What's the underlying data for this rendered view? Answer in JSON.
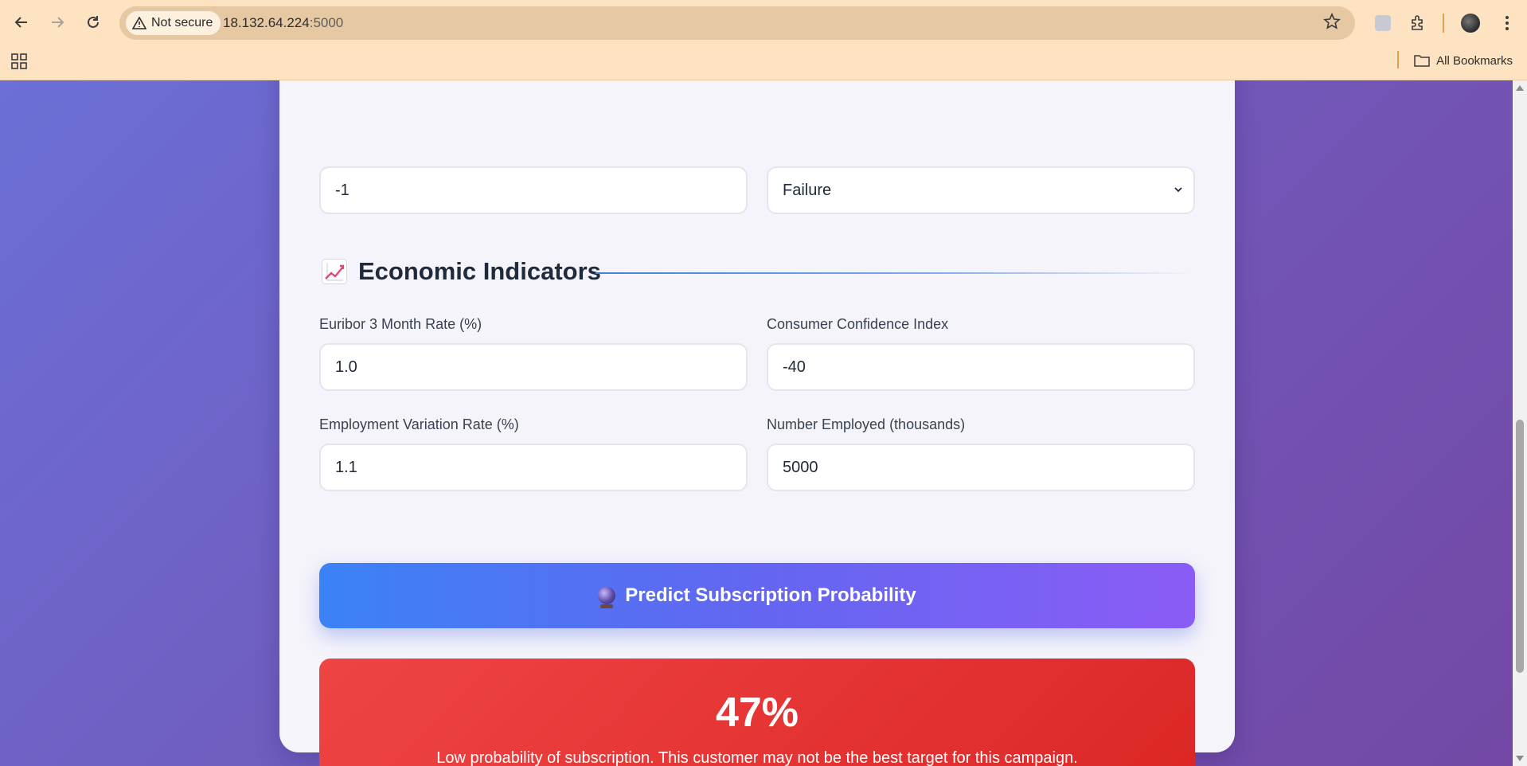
{
  "browser": {
    "security_label": "Not secure",
    "url_host": "18.132.64.224",
    "url_port": ":5000",
    "bookmarks_folder": "All Bookmarks"
  },
  "form": {
    "previous_contacts_value": "-1",
    "previous_outcome_value": "Failure"
  },
  "section": {
    "icon": "chart-increasing-icon",
    "title": "Economic Indicators"
  },
  "fields": {
    "euribor": {
      "label": "Euribor 3 Month Rate (%)",
      "value": "1.0"
    },
    "consumer_confidence": {
      "label": "Consumer Confidence Index",
      "value": "-40"
    },
    "employment_variation": {
      "label": "Employment Variation Rate (%)",
      "value": "1.1"
    },
    "number_employed": {
      "label": "Number Employed (thousands)",
      "value": "5000"
    }
  },
  "predict_button": {
    "icon": "crystal-ball-icon",
    "label": "Predict Subscription Probability"
  },
  "result": {
    "probability": "47%",
    "message": "Low probability of subscription. This customer may not be the best target for this campaign.",
    "color": "#dc2626"
  },
  "colors": {
    "accent_blue": "#3b82f6",
    "accent_purple": "#8b5cf6",
    "background": "#6f5ec4"
  }
}
